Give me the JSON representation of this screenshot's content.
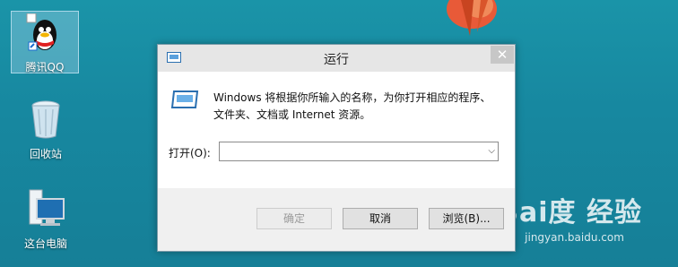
{
  "desktop": {
    "icons": [
      {
        "label": "腾讯QQ"
      },
      {
        "label": "回收站"
      },
      {
        "label": "这台电脑"
      }
    ]
  },
  "watermark": {
    "main": "Bai度 经验",
    "sub": "jingyan.baidu.com"
  },
  "dialog": {
    "title": "运行",
    "close_symbol": "✕",
    "description": "Windows 将根据你所输入的名称，为你打开相应的程序、文件夹、文档或 Internet 资源。",
    "open_label": "打开(O):",
    "open_value": "",
    "buttons": {
      "ok": "确定",
      "cancel": "取消",
      "browse": "浏览(B)..."
    }
  }
}
